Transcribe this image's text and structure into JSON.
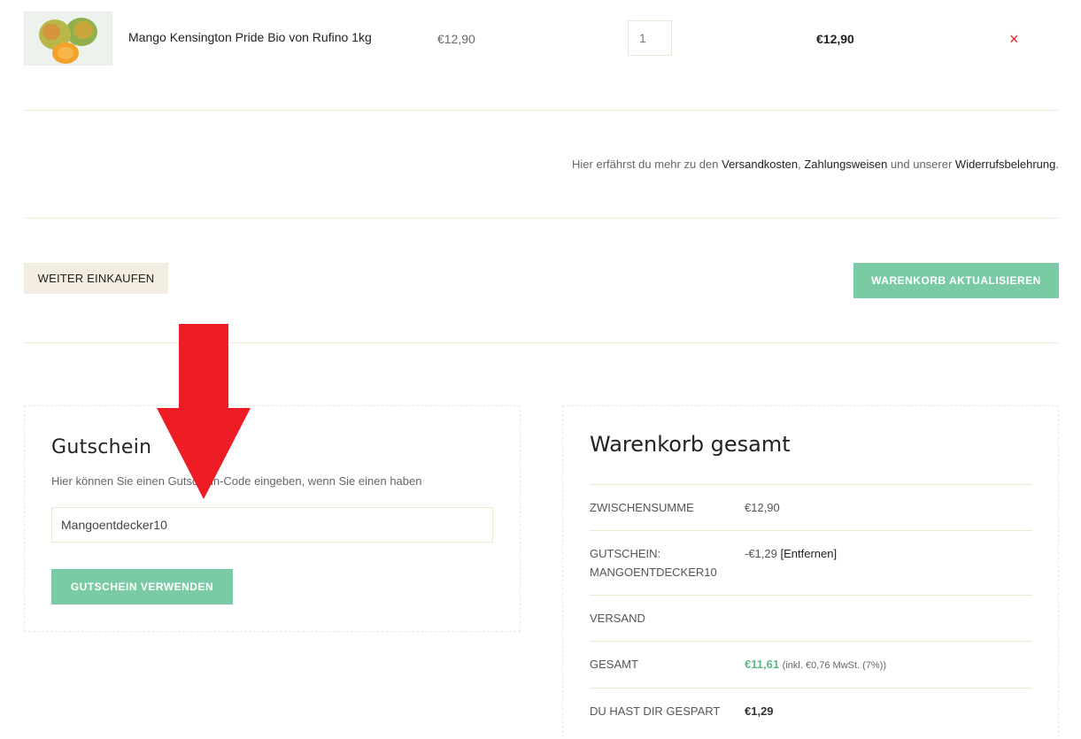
{
  "cart_item": {
    "image_alt": "Mango",
    "name": "Mango Kensington Pride Bio von Rufino 1kg",
    "price": "€12,90",
    "quantity": "1",
    "subtotal": "€12,90",
    "remove_icon": "×"
  },
  "info": {
    "prefix": "Hier erfährst du mehr zu den ",
    "shipping_link": "Versandkosten",
    "sep1": ", ",
    "payment_link": "Zahlungsweisen",
    "mid": " und unserer ",
    "withdrawal_link": "Widerrufsbelehrung",
    "suffix": "."
  },
  "actions": {
    "continue_label": "WEITER EINKAUFEN",
    "update_label": "WARENKORB AKTUALISIEREN"
  },
  "coupon": {
    "title": "Gutschein",
    "description": "Hier können Sie einen Gutschein-Code eingeben, wenn Sie einen haben",
    "input_value": "Mangoentdecker10",
    "apply_label": "GUTSCHEIN VERWENDEN"
  },
  "totals": {
    "title": "Warenkorb gesamt",
    "subtotal_label": "ZWISCHENSUMME",
    "subtotal_value": "€12,90",
    "coupon_label_1": "GUTSCHEIN:",
    "coupon_label_2": "MANGOENTDECKER10",
    "coupon_value": "-€1,29",
    "coupon_remove": "[Entfernen]",
    "shipping_label": "VERSAND",
    "total_label": "GESAMT",
    "total_value": "€11,61",
    "tax_prefix": "(inkl. ",
    "tax_value": "€0,76",
    "tax_suffix": " MwSt. (7%))",
    "saved_label": "DU HAST DIR GESPART",
    "saved_value": "€1,29"
  },
  "colors": {
    "accent": "#7acaa5",
    "remove": "#dd2222",
    "arrow": "#ee1c25"
  }
}
